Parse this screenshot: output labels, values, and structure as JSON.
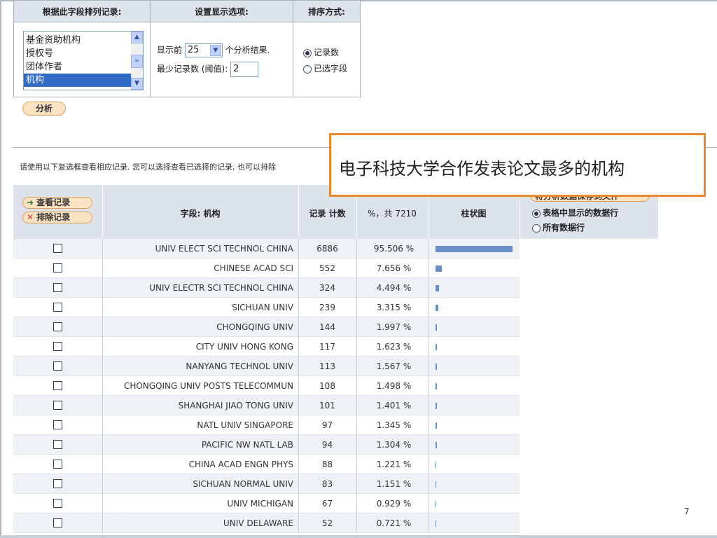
{
  "options_panel": {
    "sort_field_header": "根据此字段排列记录:",
    "display_header": "设置显示选项:",
    "sort_method_header": "排序方式:",
    "field_list": [
      "基金资助机构",
      "授权号",
      "团体作者",
      "机构"
    ],
    "selected_field": "机构",
    "show_top_prefix": "显示前",
    "show_top_value": "25",
    "show_top_suffix": "个分析结果.",
    "min_records_label": "最少记录数 (阈值):",
    "min_records_value": "2",
    "sort_options": [
      "记录数",
      "已选字段"
    ],
    "sort_selected": "记录数",
    "analyze_button": "分析"
  },
  "instruction": "请使用以下复选框查看相应记录. 您可以选择查看已选择的记录, 也可以排除",
  "callout": "电子科技大学合作发表论文最多的机构",
  "results_header": {
    "view_records": "查看记录",
    "exclude_records": "排除记录",
    "field_col": "字段: 机构",
    "count_col": "记录 计数",
    "percent_col": "%，共 7210",
    "bar_col": "柱状图",
    "output_label": "将分析数据保存到文件",
    "output_options": [
      "表格中显示的数据行",
      "所有数据行"
    ],
    "output_selected": "表格中显示的数据行"
  },
  "results": [
    {
      "name": "UNIV ELECT SCI TECHNOL CHINA",
      "count": "6886",
      "percent": "95.506 %"
    },
    {
      "name": "CHINESE ACAD SCI",
      "count": "552",
      "percent": "7.656 %"
    },
    {
      "name": "UNIV ELECTR SCI TECHNOL CHINA",
      "count": "324",
      "percent": "4.494 %"
    },
    {
      "name": "SICHUAN UNIV",
      "count": "239",
      "percent": "3.315 %"
    },
    {
      "name": "CHONGQING UNIV",
      "count": "144",
      "percent": "1.997 %"
    },
    {
      "name": "CITY UNIV HONG KONG",
      "count": "117",
      "percent": "1.623 %"
    },
    {
      "name": "NANYANG TECHNOL UNIV",
      "count": "113",
      "percent": "1.567 %"
    },
    {
      "name": "CHONGQING UNIV POSTS TELECOMMUN",
      "count": "108",
      "percent": "1.498 %"
    },
    {
      "name": "SHANGHAI JIAO TONG UNIV",
      "count": "101",
      "percent": "1.401 %"
    },
    {
      "name": "NATL UNIV SINGAPORE",
      "count": "97",
      "percent": "1.345 %"
    },
    {
      "name": "PACIFIC NW NATL LAB",
      "count": "94",
      "percent": "1.304 %"
    },
    {
      "name": "CHINA ACAD ENGN PHYS",
      "count": "88",
      "percent": "1.221 %"
    },
    {
      "name": "SICHUAN NORMAL UNIV",
      "count": "83",
      "percent": "1.151 %"
    },
    {
      "name": "UNIV MICHIGAN",
      "count": "67",
      "percent": "0.929 %"
    },
    {
      "name": "UNIV DELAWARE",
      "count": "52",
      "percent": "0.721 %"
    }
  ],
  "page_number": "7",
  "colors": {
    "bar": "#6a8fc8",
    "accent": "#ec8a2b",
    "header_bg": "#dde3ea",
    "selected": "#316ac5"
  }
}
